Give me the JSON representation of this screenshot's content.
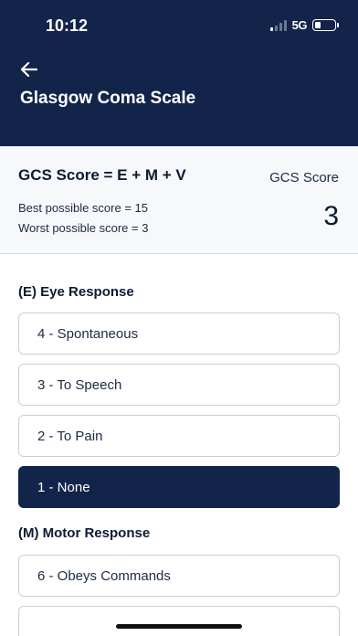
{
  "status_bar": {
    "time": "10:12",
    "network": "5G"
  },
  "header": {
    "title": "Glasgow Coma Scale",
    "back_icon": "arrow-left-icon"
  },
  "summary": {
    "formula": "GCS Score = E + M + V",
    "best": "Best possible score = 15",
    "worst": "Worst possible score = 3",
    "score_label": "GCS Score",
    "score_value": "3"
  },
  "eye": {
    "title": "(E) Eye Response",
    "options": [
      "4 - Spontaneous",
      "3 - To Speech",
      "2 - To Pain",
      "1 - None"
    ],
    "selected": "1 - None"
  },
  "motor": {
    "title": "(M) Motor Response",
    "options": [
      "6 - Obeys Commands"
    ]
  },
  "colors": {
    "primary": "#12244a",
    "background": "#f7f8fb"
  }
}
